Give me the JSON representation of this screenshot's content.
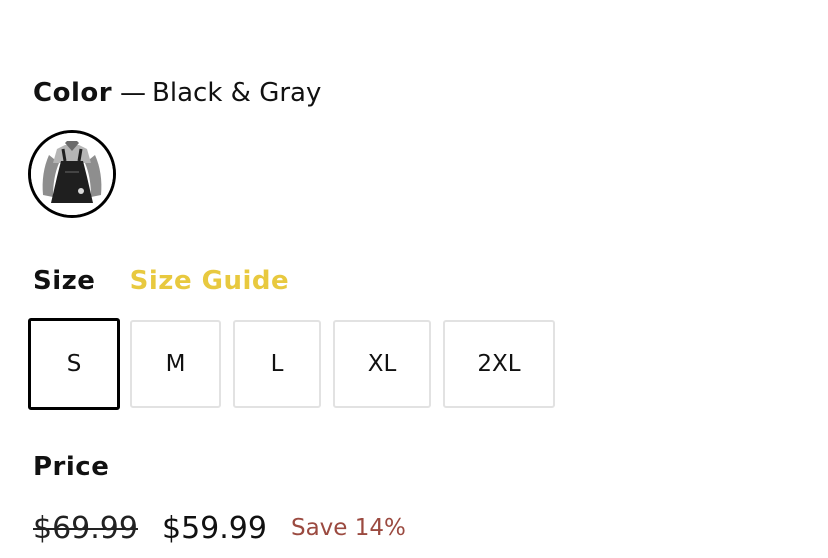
{
  "color": {
    "label": "Color",
    "dash": "—",
    "value": "Black & Gray",
    "swatch_icon": "dress-thumbnail"
  },
  "size": {
    "label": "Size",
    "guide_label": "Size Guide",
    "guide_color": "#e8c93f",
    "options": [
      "S",
      "M",
      "L",
      "XL",
      "2XL"
    ],
    "selected": "S"
  },
  "price": {
    "label": "Price",
    "original": "$69.99",
    "current": "$59.99",
    "save": "Save 14%",
    "save_color": "#9b4a40"
  }
}
